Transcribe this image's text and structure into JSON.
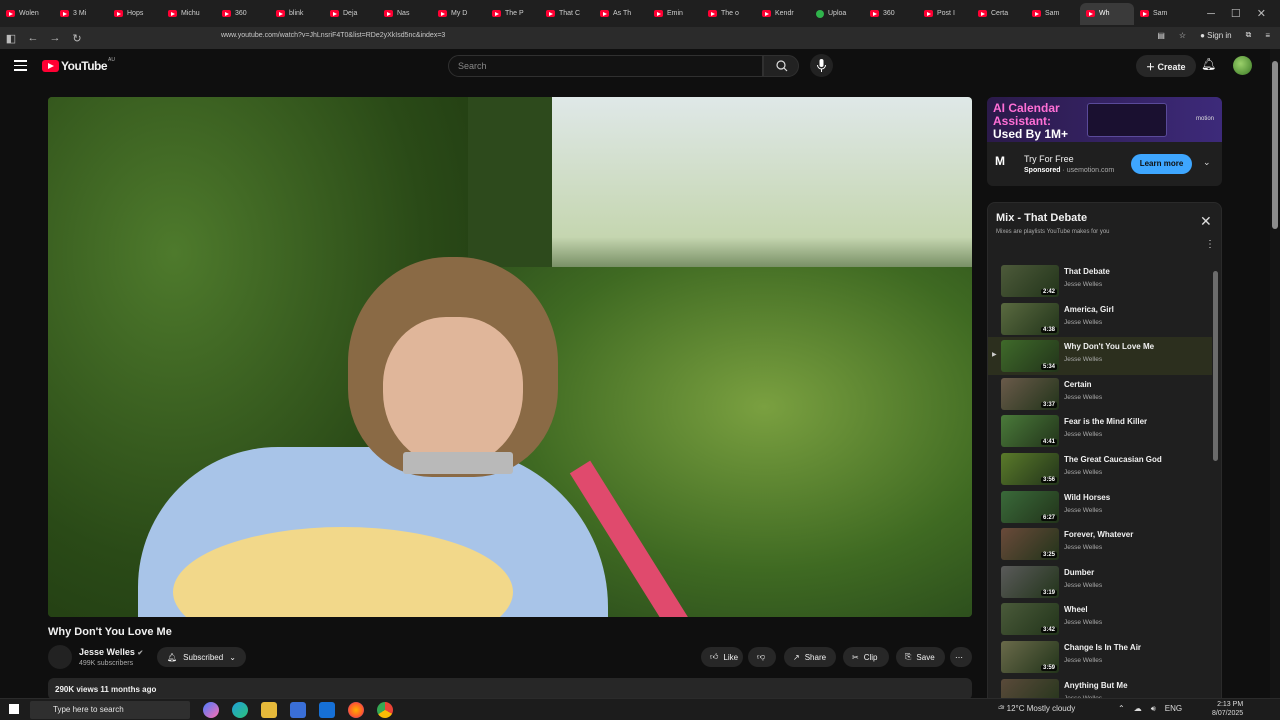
{
  "browser": {
    "tabs": [
      "Wolen",
      "3 Mi",
      "Hops",
      "Michu",
      "360",
      "blink",
      "Deja",
      "Nas",
      "My D",
      "The P",
      "That C",
      "As Th",
      "Emin",
      "The o",
      "Kendr",
      "Uploa",
      "360",
      "Post I",
      "Certa",
      "Sam",
      "Wh",
      "Sam"
    ],
    "active_tab_index": 20,
    "url": "www.youtube.com/watch?v=JhLnsriF4T0&list=RDe2yXkIsd5nc&index=3",
    "sign_in": "Sign in"
  },
  "header": {
    "logo_text": "YouTube",
    "country": "AU",
    "search_placeholder": "Search",
    "create_label": "Create"
  },
  "video": {
    "title": "Why Don't You Love Me",
    "channel": "Jesse Welles",
    "subscribers": "499K subscribers",
    "subscribed_label": "Subscribed",
    "like_label": "Like",
    "share_label": "Share",
    "clip_label": "Clip",
    "save_label": "Save",
    "views_age": "290K views  11 months ago"
  },
  "ad": {
    "headline_1": "AI Calendar",
    "headline_2": "Assistant:",
    "headline_3": "Used By 1M+",
    "brand": "motion",
    "logo_text": "M",
    "title": "Try For Free",
    "sponsored": "Sponsored",
    "domain": " · usemotion.com",
    "cta": "Learn more"
  },
  "playlist": {
    "title": "Mix - That Debate",
    "subtitle": "Mixes are playlists YouTube makes for you",
    "items": [
      {
        "title": "That Debate",
        "artist": "Jesse Welles",
        "duration": "2:42",
        "color": "#4d5a3a"
      },
      {
        "title": "America, Girl",
        "artist": "Jesse Welles",
        "duration": "4:38",
        "color": "#5a6a40"
      },
      {
        "title": "Why Don't You Love Me",
        "artist": "Jesse Welles",
        "duration": "5:34",
        "color": "#3f6a2a"
      },
      {
        "title": "Certain",
        "artist": "Jesse Welles",
        "duration": "3:37",
        "color": "#6a5a4a"
      },
      {
        "title": "Fear is the Mind Killer",
        "artist": "Jesse Welles",
        "duration": "4:41",
        "color": "#4a7a3a"
      },
      {
        "title": "The Great Caucasian God",
        "artist": "Jesse Welles",
        "duration": "3:56",
        "color": "#5a7a2a"
      },
      {
        "title": "Wild Horses",
        "artist": "Jesse Welles",
        "duration": "6:27",
        "color": "#3a6a3a"
      },
      {
        "title": "Forever, Whatever",
        "artist": "Jesse Welles",
        "duration": "3:25",
        "color": "#6a4a3a"
      },
      {
        "title": "Dumber",
        "artist": "Jesse Welles",
        "duration": "3:19",
        "color": "#5a5a5a"
      },
      {
        "title": "Wheel",
        "artist": "Jesse Welles",
        "duration": "3:42",
        "color": "#4a5a3a"
      },
      {
        "title": "Change Is In The Air",
        "artist": "Jesse Welles",
        "duration": "3:59",
        "color": "#6a6a4a"
      },
      {
        "title": "Anything But Me",
        "artist": "Jesse Welles",
        "duration": "",
        "color": "#5a4a3a"
      }
    ],
    "current_index": 2
  },
  "taskbar": {
    "search_placeholder": "Type here to search",
    "weather": "12°C  Mostly cloudy",
    "language": "ENG",
    "time": "2:13 PM",
    "date": "8/07/2025"
  },
  "colors": {
    "accent": "#3ea6ff",
    "brand": "#ff0033",
    "bg": "#0f0f0f"
  }
}
